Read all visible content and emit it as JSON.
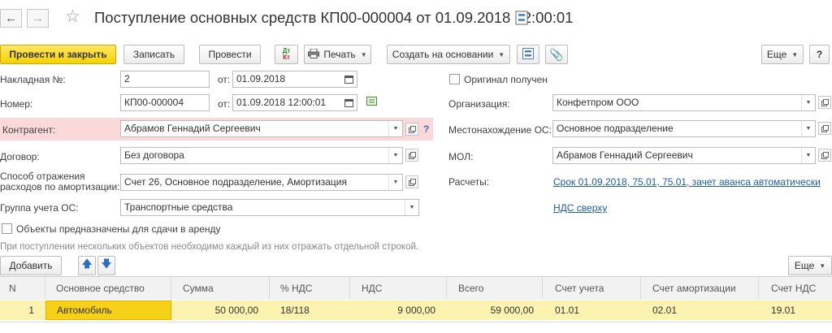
{
  "window": {
    "title": "Поступление основных средств КП00-000004 от 01.09.2018 12:00:01",
    "back_icon": "arrow-left-icon",
    "forward_icon": "arrow-right-icon",
    "favorite_icon": "star-icon",
    "link_icon": "structure-icon"
  },
  "toolbar": {
    "post_close": "Провести и закрыть",
    "save": "Записать",
    "post": "Провести",
    "dt_kt_top": "Дт",
    "dt_kt_bottom": "Кт",
    "print": "Печать",
    "create_based": "Создать на основании",
    "more": "Еще",
    "help": "?"
  },
  "form": {
    "invoice_label": "Накладная №:",
    "invoice_value": "2",
    "invoice_date_label": "от:",
    "invoice_date": "01.09.2018",
    "number_label": "Номер:",
    "number_value": "КП00-000004",
    "number_date_label": "от:",
    "number_date": "01.09.2018 12:00:01",
    "counterparty_label": "Контрагент:",
    "counterparty_value": "Абрамов Геннадий Сергеевич",
    "counterparty_help": "?",
    "contract_label": "Договор:",
    "contract_value": "Без договора",
    "depreciation_label_1": "Способ отражения",
    "depreciation_label_2": "расходов по амортизации:",
    "depreciation_value": "Счет 26, Основное подразделение, Амортизация",
    "group_label": "Группа учета ОС:",
    "group_value": "Транспортные средства",
    "rent_checkbox": "Объекты предназначены для сдачи в аренду",
    "hint": "При поступлении нескольких объектов необходимо каждый из них отражать отдельной строкой.",
    "original_checkbox": "Оригинал получен",
    "org_label": "Организация:",
    "org_value": "Конфетпром ООО",
    "location_label": "Местонахождение ОС:",
    "location_value": "Основное подразделение",
    "mol_label": "МОЛ:",
    "mol_value": "Абрамов Геннадий Сергеевич",
    "settlements_label": "Расчеты:",
    "settlements_link": "Срок 01.09.2018, 75.01, 75.01, зачет аванса автоматически",
    "vat_link": "НДС сверху"
  },
  "table_toolbar": {
    "add": "Добавить",
    "more": "Еще"
  },
  "table": {
    "columns": [
      "N",
      "Основное средство",
      "Сумма",
      "% НДС",
      "НДС",
      "Всего",
      "Счет учета",
      "Счет амортизации",
      "Счет НДС"
    ],
    "rows": [
      [
        "1",
        "Автомобиль",
        "50 000,00",
        "18/118",
        "9 000,00",
        "59 000,00",
        "01.01",
        "02.01",
        "19.01"
      ]
    ]
  },
  "colors": {
    "primary_button": "#f5d200",
    "required_highlight": "#fbd9da",
    "selected_row": "#fdf3b1",
    "selected_cell": "#f7d117",
    "link": "#1f5ba8"
  }
}
